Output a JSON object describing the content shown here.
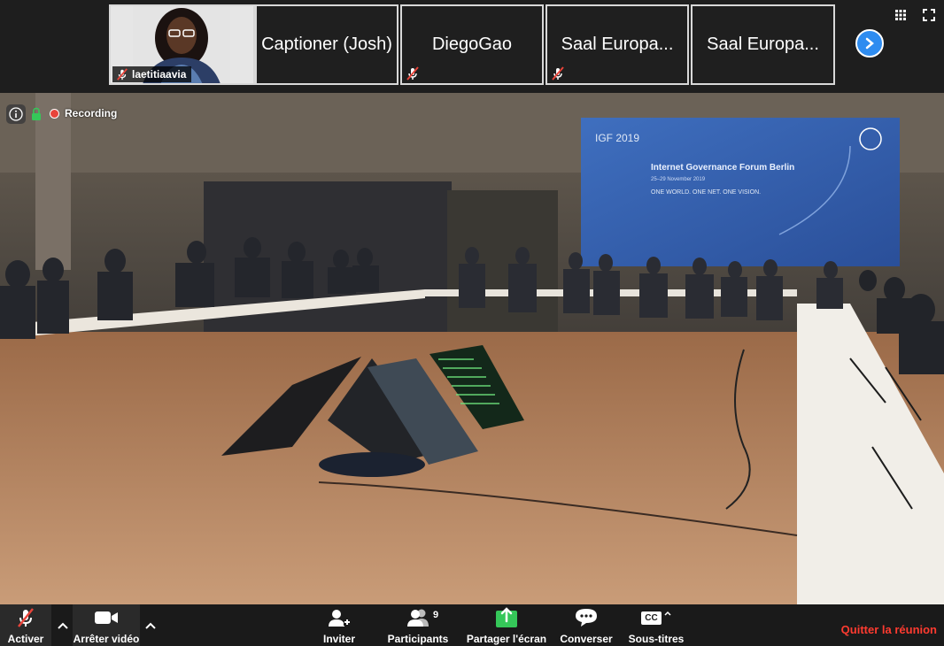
{
  "participants": [
    {
      "name": "laetitiaavia",
      "muted": true,
      "has_video": true
    },
    {
      "name": "Captioner (Josh)",
      "muted": false
    },
    {
      "name": "DiegoGao",
      "muted": true
    },
    {
      "name": "Saal Europa...",
      "muted": true
    },
    {
      "name": "Saal Europa...",
      "muted": false
    }
  ],
  "recording": {
    "label": "Recording"
  },
  "venue_banner": {
    "logo": "IGF 2019",
    "title": "Internet Governance Forum Berlin",
    "dates": "25–29 November 2019",
    "slogan": "ONE WORLD. ONE NET. ONE VISION."
  },
  "toolbar": {
    "mute_label": "Activer",
    "video_label": "Arrêter vidéo",
    "invite_label": "Inviter",
    "participants_label": "Participants",
    "participants_count": "9",
    "share_label": "Partager l'écran",
    "chat_label": "Converser",
    "captions_label": "Sous-titres",
    "captions_badge": "CC",
    "leave_label": "Quitter la réunion"
  },
  "colors": {
    "accent": "#2e8cf0",
    "share_green": "#35c759",
    "leave_red": "#ff3b30",
    "record_red": "#e8443a"
  }
}
